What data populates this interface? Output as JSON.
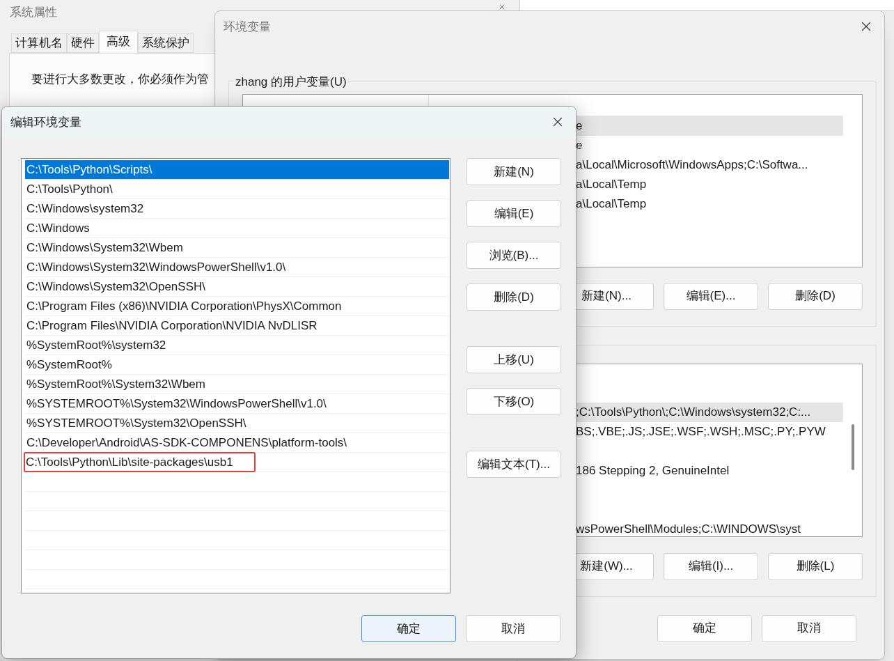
{
  "system_properties": {
    "title": "系统属性",
    "tabs": [
      {
        "label": "计算机名",
        "selected": false
      },
      {
        "label": "硬件",
        "selected": false
      },
      {
        "label": "高级",
        "selected": true
      },
      {
        "label": "系统保护",
        "selected": false
      }
    ],
    "notice": "要进行大多数更改，你必须作为管"
  },
  "environment_variables": {
    "title": "环境变量",
    "user_group_title": "zhang 的用户变量(U)",
    "user_rows": [
      {
        "kind": "text",
        "value": "e",
        "selected": true
      },
      {
        "kind": "text",
        "value": "e",
        "selected": false
      },
      {
        "kind": "text",
        "value": "a\\Local\\Microsoft\\WindowsApps;C:\\Softwa...",
        "selected": false
      },
      {
        "kind": "text",
        "value": "a\\Local\\Temp",
        "selected": false
      },
      {
        "kind": "text",
        "value": "a\\Local\\Temp",
        "selected": false
      }
    ],
    "user_buttons": [
      "新建(N)...",
      "编辑(E)...",
      "删除(D)"
    ],
    "system_rows": [
      {
        "kind": "blank",
        "selected": false
      },
      {
        "kind": "text",
        "value": ";C:\\Tools\\Python\\;C:\\Windows\\system32;C:...",
        "selected": true
      },
      {
        "kind": "text",
        "value": "BS;.VBE;.JS;.JSE;.WSF;.WSH;.MSC;.PY;.PYW",
        "selected": false
      },
      {
        "kind": "blank",
        "selected": false
      },
      {
        "kind": "text",
        "value": "186 Stepping 2, GenuineIntel",
        "selected": false
      },
      {
        "kind": "blank",
        "selected": false
      },
      {
        "kind": "blank",
        "selected": false
      },
      {
        "kind": "text",
        "value": "wsPowerShell\\Modules;C:\\WINDOWS\\syst",
        "selected": false
      }
    ],
    "system_buttons": [
      "新建(W)...",
      "编辑(I)...",
      "删除(L)"
    ],
    "buttons": [
      "确定",
      "取消"
    ]
  },
  "edit_dialog": {
    "title": "编辑环境变量",
    "paths": [
      {
        "text": "C:\\Tools\\Python\\Scripts\\",
        "selected": true,
        "highlighted": false
      },
      {
        "text": "C:\\Tools\\Python\\",
        "selected": false,
        "highlighted": false
      },
      {
        "text": "C:\\Windows\\system32",
        "selected": false,
        "highlighted": false
      },
      {
        "text": "C:\\Windows",
        "selected": false,
        "highlighted": false
      },
      {
        "text": "C:\\Windows\\System32\\Wbem",
        "selected": false,
        "highlighted": false
      },
      {
        "text": "C:\\Windows\\System32\\WindowsPowerShell\\v1.0\\",
        "selected": false,
        "highlighted": false
      },
      {
        "text": "C:\\Windows\\System32\\OpenSSH\\",
        "selected": false,
        "highlighted": false
      },
      {
        "text": "C:\\Program Files (x86)\\NVIDIA Corporation\\PhysX\\Common",
        "selected": false,
        "highlighted": false
      },
      {
        "text": "C:\\Program Files\\NVIDIA Corporation\\NVIDIA NvDLISR",
        "selected": false,
        "highlighted": false
      },
      {
        "text": "%SystemRoot%\\system32",
        "selected": false,
        "highlighted": false
      },
      {
        "text": "%SystemRoot%",
        "selected": false,
        "highlighted": false
      },
      {
        "text": "%SystemRoot%\\System32\\Wbem",
        "selected": false,
        "highlighted": false
      },
      {
        "text": "%SYSTEMROOT%\\System32\\WindowsPowerShell\\v1.0\\",
        "selected": false,
        "highlighted": false
      },
      {
        "text": "%SYSTEMROOT%\\System32\\OpenSSH\\",
        "selected": false,
        "highlighted": false
      },
      {
        "text": "C:\\Developer\\Android\\AS-SDK-COMPONENS\\platform-tools\\",
        "selected": false,
        "highlighted": false
      },
      {
        "text": "C:\\Tools\\Python\\Lib\\site-packages\\usb1",
        "selected": false,
        "highlighted": true
      }
    ],
    "side_button_groups": [
      [
        "新建(N)",
        "编辑(E)",
        "浏览(B)...",
        "删除(D)"
      ],
      [
        "上移(U)",
        "下移(O)"
      ],
      [
        "编辑文本(T)..."
      ]
    ],
    "buttons": [
      {
        "label": "确定",
        "default": true
      },
      {
        "label": "取消",
        "default": false
      }
    ]
  }
}
